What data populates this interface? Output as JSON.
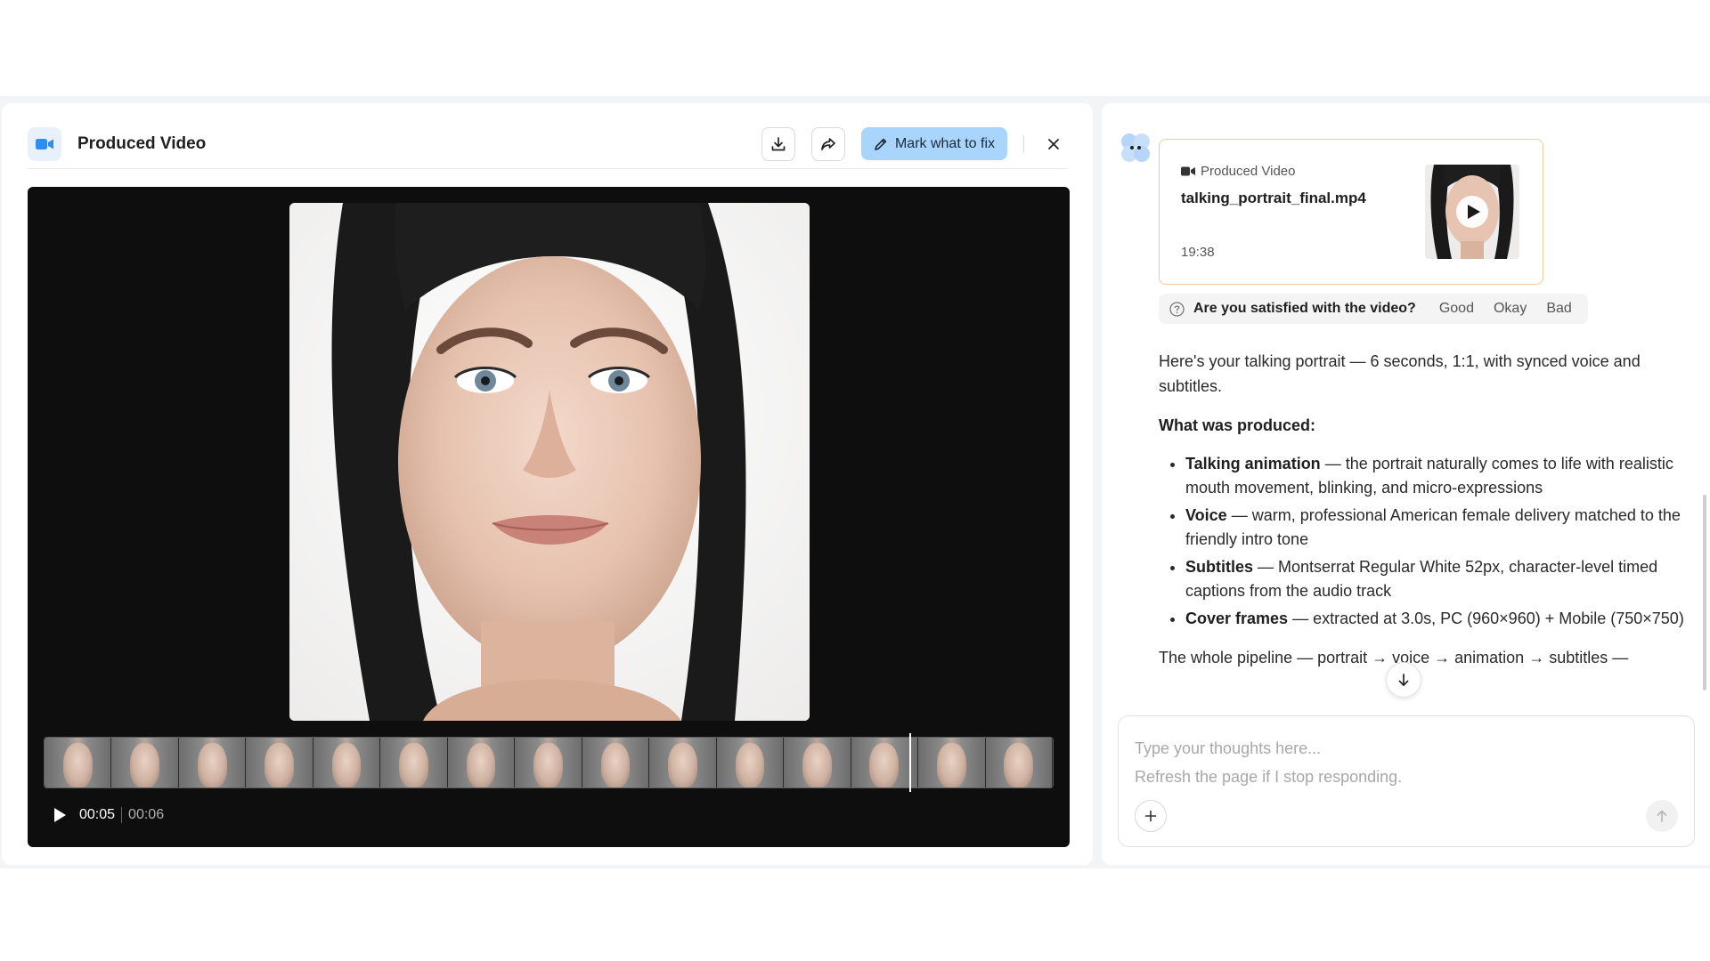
{
  "viewer": {
    "title": "Produced Video",
    "mark_fix_label": "Mark what to fix",
    "current_time": "00:05",
    "total_time": "00:06",
    "filmstrip_frames": 15,
    "playhead_progress": 0.857
  },
  "chat": {
    "card": {
      "label": "Produced Video",
      "filename": "talking_portrait_final.mp4",
      "time": "19:38"
    },
    "feedback": {
      "question": "Are you satisfied with the video?",
      "options": [
        "Good",
        "Okay",
        "Bad"
      ]
    },
    "message": {
      "intro": "Here's your talking portrait — 6 seconds, 1:1, with synced voice and subtitles.",
      "heading": "What was produced:",
      "items": [
        {
          "title": "Talking animation",
          "text": " — the portrait naturally comes to life with realistic mouth movement, blinking, and micro-expressions"
        },
        {
          "title": "Voice",
          "text": " — warm, professional American female delivery matched to the friendly intro tone"
        },
        {
          "title": "Subtitles",
          "text": " — Montserrat Regular White 52px, character-level timed captions from the audio track"
        },
        {
          "title": "Cover frames",
          "text": " — extracted at 3.0s, PC (960×960) + Mobile (750×750)"
        }
      ],
      "outro": "The whole pipeline — portrait → voice → animation → subtitles —"
    },
    "composer": {
      "placeholder": "Type your thoughts here...\nRefresh the page if I stop responding."
    }
  },
  "colors": {
    "accent": "#a9d4fb",
    "card_border": "#f3c99d",
    "player_bg": "#0e0e0e"
  }
}
